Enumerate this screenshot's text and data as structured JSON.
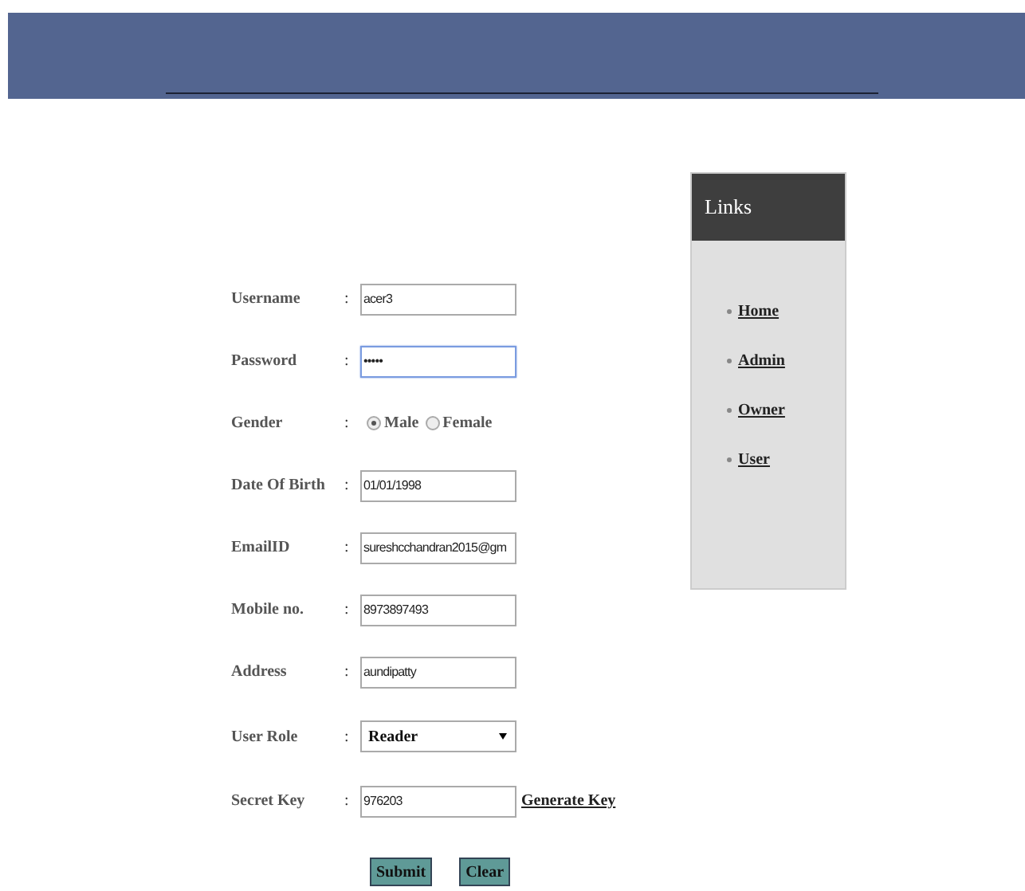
{
  "form": {
    "fields": [
      {
        "kind": "text",
        "label": "Username",
        "separator": ":",
        "value": "acer3",
        "focused": false
      },
      {
        "kind": "text",
        "label": "Password",
        "separator": ":",
        "value": "•••••",
        "focused": true
      },
      {
        "kind": "radio",
        "label": "Gender",
        "separator": ":",
        "options": [
          {
            "label": "Male",
            "selected": true
          },
          {
            "label": "Female",
            "selected": false
          }
        ]
      },
      {
        "kind": "text",
        "label": "Date Of Birth",
        "separator": ":",
        "value": "01/01/1998",
        "focused": false
      },
      {
        "kind": "text",
        "label": "EmailID",
        "separator": ":",
        "value": "sureshcchandran2015@gm",
        "focused": false
      },
      {
        "kind": "text",
        "label": "Mobile no.",
        "separator": ":",
        "value": "8973897493",
        "focused": false
      },
      {
        "kind": "text",
        "label": "Address",
        "separator": ":",
        "value": "aundipatty",
        "focused": false
      },
      {
        "kind": "select",
        "label": "User Role",
        "separator": ":",
        "value": "Reader"
      },
      {
        "kind": "text",
        "label": "Secret Key",
        "separator": ":",
        "value": "976203",
        "focused": false,
        "link": "Generate Key"
      }
    ],
    "buttons": [
      "Submit",
      "Clear"
    ]
  },
  "links": {
    "title": "Links",
    "items": [
      "Home",
      "Admin",
      "Owner",
      "User"
    ]
  }
}
